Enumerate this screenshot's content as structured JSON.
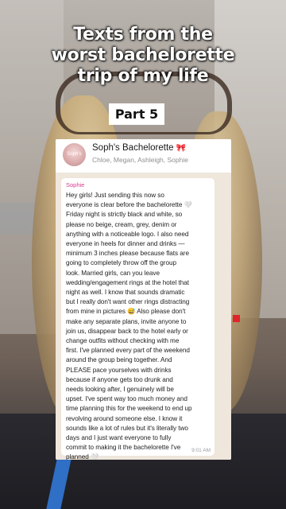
{
  "overlay": {
    "title_lines": [
      "Texts from the",
      "worst bachelorette",
      "trip of my life"
    ],
    "part_label": "Part 5"
  },
  "chat": {
    "group_name": "Soph's Bachelorette",
    "group_emoji": "🎀",
    "members": "Chloe, Megan, Ashleigh, Sophie",
    "avatar_text": "Soph's",
    "message": {
      "sender": "Sophie",
      "lines": [
        "Hey girls! Just sending this now so",
        "everyone is clear before the bachelorette 🤍",
        "Friday night is strictly black and white, so",
        "please no beige, cream, grey, denim or",
        "anything with a noticeable logo. I also need",
        "everyone in heels for dinner and drinks —",
        "minimum 3 inches please because flats are",
        "going to completely throw off the group",
        "look. Married girls, can you leave",
        "wedding/engagement rings at the hotel that",
        "night as well. I know that sounds dramatic",
        "but I really don't want other rings distracting",
        "from mine in pictures 😅 Also please don't",
        "make any separate plans, invite anyone to",
        "join us, disappear back to the hotel early or",
        "change outfits without checking with me",
        "first. I've planned every part of the weekend",
        "around the group being together. And",
        "PLEASE pace yourselves with drinks",
        "because if anyone gets too drunk and",
        "needs looking after, I genuinely will be",
        "upset. I've spent way too much money and",
        "time planning this for the weekend to end up",
        "revolving around someone else. I know it",
        "sounds like a lot of rules but it's literally two",
        "days and I just want everyone to fully",
        "commit to making it the bachelorette I've",
        "planned 🤍"
      ],
      "time": "9:01 AM"
    }
  }
}
